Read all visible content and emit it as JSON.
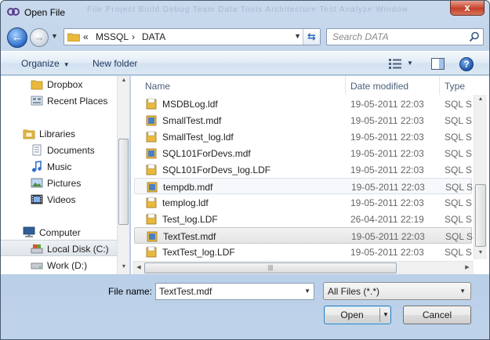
{
  "window": {
    "title": "Open File",
    "close_glyph": "x",
    "background_menu": "File   Project   Build   Debug   Team   Data   Tools   Architecture   Test   Analyze   Window"
  },
  "address": {
    "overflow": "«",
    "segments": [
      "MSSQL",
      "DATA"
    ],
    "separator": "›"
  },
  "search": {
    "placeholder": "Search DATA"
  },
  "toolbar": {
    "organize_label": "Organize",
    "new_folder_label": "New folder",
    "help_glyph": "?"
  },
  "nav_pane": {
    "items": [
      {
        "label": "Dropbox",
        "icon": "folder-icon"
      },
      {
        "label": "Recent Places",
        "icon": "recent-places-icon"
      },
      {
        "label": "Libraries",
        "icon": "libraries-icon"
      },
      {
        "label": "Documents",
        "icon": "documents-icon"
      },
      {
        "label": "Music",
        "icon": "music-icon"
      },
      {
        "label": "Pictures",
        "icon": "pictures-icon"
      },
      {
        "label": "Videos",
        "icon": "videos-icon"
      },
      {
        "label": "Computer",
        "icon": "computer-icon"
      },
      {
        "label": "Local Disk (C:)",
        "icon": "local-disk-icon"
      },
      {
        "label": "Work (D:)",
        "icon": "drive-icon"
      }
    ],
    "selected_index": 8
  },
  "file_list": {
    "columns": [
      "Name",
      "Date modified",
      "Type"
    ],
    "rows": [
      {
        "name": "MSDBLog.ldf",
        "date": "19-05-2011 22:03",
        "type": "SQL Se"
      },
      {
        "name": "SmallTest.mdf",
        "date": "19-05-2011 22:03",
        "type": "SQL Se"
      },
      {
        "name": "SmallTest_log.ldf",
        "date": "19-05-2011 22:03",
        "type": "SQL Se"
      },
      {
        "name": "SQL101ForDevs.mdf",
        "date": "19-05-2011 22:03",
        "type": "SQL Se"
      },
      {
        "name": "SQL101ForDevs_log.LDF",
        "date": "19-05-2011 22:03",
        "type": "SQL Se"
      },
      {
        "name": "tempdb.mdf",
        "date": "19-05-2011 22:03",
        "type": "SQL Se"
      },
      {
        "name": "templog.ldf",
        "date": "19-05-2011 22:03",
        "type": "SQL Se"
      },
      {
        "name": "Test_log.LDF",
        "date": "26-04-2011 22:19",
        "type": "SQL Se"
      },
      {
        "name": "TextTest.mdf",
        "date": "19-05-2011 22:03",
        "type": "SQL Se"
      },
      {
        "name": "TextTest_log.LDF",
        "date": "19-05-2011 22:03",
        "type": "SQL Se"
      }
    ],
    "hovered_index": 5,
    "selected_index": 8
  },
  "footer": {
    "file_name_label": "File name:",
    "file_name_value": "TextTest.mdf",
    "filter_value": "All Files (*.*)",
    "open_label": "Open",
    "cancel_label": "Cancel"
  },
  "colors": {
    "accent": "#2a6bc8",
    "close": "#c4402a",
    "folder": "#e8b93c"
  }
}
